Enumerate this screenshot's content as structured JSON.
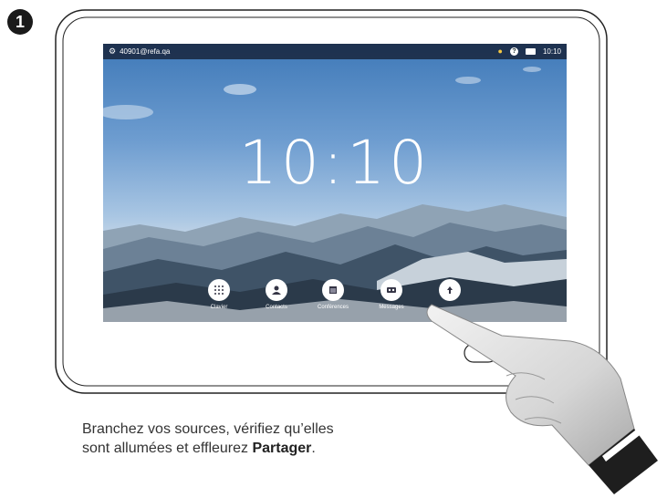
{
  "step": {
    "number": "1"
  },
  "status_bar": {
    "address": "40901@refa.qa",
    "time": "10:10",
    "icons": [
      "gear-icon",
      "lightbulb-icon",
      "help-icon",
      "camera-self-view-icon"
    ]
  },
  "main": {
    "clock": "10:10"
  },
  "buttons": [
    {
      "label": "Clavier",
      "icon": "keypad-icon"
    },
    {
      "label": "Contacts",
      "icon": "contacts-icon"
    },
    {
      "label": "Conférences",
      "icon": "calendar-icon"
    },
    {
      "label": "Messages",
      "icon": "voicemail-icon"
    },
    {
      "label": "",
      "icon": "share-icon"
    }
  ],
  "caption": {
    "line1": "Branchez vos sources, vérifiez qu’elles",
    "line2_prefix": "sont allumées et effleurez ",
    "line2_bold": "Partager",
    "line2_suffix": "."
  }
}
